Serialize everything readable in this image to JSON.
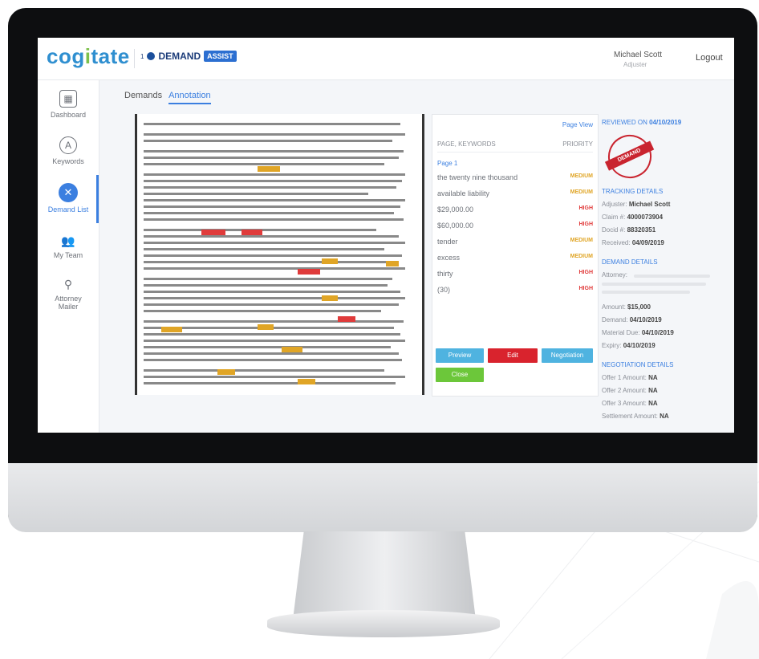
{
  "app": {
    "logo_prefix": "cog",
    "logo_i": "i",
    "logo_suffix": "tate",
    "product_number": "1",
    "product_name": "DEMAND",
    "product_badge": "ASSIST",
    "user_name": "Michael Scott",
    "user_role": "Adjuster",
    "logout": "Logout"
  },
  "sidebar": {
    "items": [
      {
        "label": "Dashboard",
        "icon": "dashboard-icon"
      },
      {
        "label": "Keywords",
        "icon": "keywords-icon"
      },
      {
        "label": "Demand List",
        "icon": "demand-list-icon",
        "active": true
      },
      {
        "label": "My Team",
        "icon": "team-icon"
      },
      {
        "label": "Attorney Mailer",
        "icon": "attorney-mailer-icon"
      }
    ]
  },
  "tabs": [
    {
      "label": "Demands"
    },
    {
      "label": "Annotation",
      "active": true
    }
  ],
  "keywords_panel": {
    "page_view": "Page View",
    "col_keywords": "PAGE, KEYWORDS",
    "col_priority": "PRIORITY",
    "page_label": "Page 1",
    "rows": [
      {
        "keyword": "the twenty nine thousand",
        "priority": "MEDIUM"
      },
      {
        "keyword": "available liability",
        "priority": "MEDIUM"
      },
      {
        "keyword": "$29,000.00",
        "priority": "HIGH"
      },
      {
        "keyword": "$60,000.00",
        "priority": "HIGH"
      },
      {
        "keyword": "tender",
        "priority": "MEDIUM"
      },
      {
        "keyword": "excess",
        "priority": "MEDIUM"
      },
      {
        "keyword": "thirty",
        "priority": "HIGH"
      },
      {
        "keyword": "(30)",
        "priority": "HIGH"
      }
    ],
    "buttons": {
      "preview": "Preview",
      "edit": "Edit",
      "negotiation": "Negotiation",
      "close": "Close"
    }
  },
  "details": {
    "reviewed_label": "REVIEWED ON",
    "reviewed_date": "04/10/2019",
    "stamp_text": "DEMAND",
    "tracking_title": "TRACKING DETAILS",
    "tracking": [
      {
        "label": "Adjuster:",
        "value": "Michael Scott"
      },
      {
        "label": "Claim #:",
        "value": "4000073904"
      },
      {
        "label": "Docid #:",
        "value": "88320351"
      },
      {
        "label": "Received:",
        "value": "04/09/2019"
      }
    ],
    "demand_title": "DEMAND DETAILS",
    "attorney_label": "Attorney:",
    "demand": [
      {
        "label": "Amount:",
        "value": "$15,000"
      },
      {
        "label": "Demand:",
        "value": "04/10/2019"
      },
      {
        "label": "Material Due:",
        "value": "04/10/2019"
      },
      {
        "label": "Expiry:",
        "value": "04/10/2019"
      }
    ],
    "negotiation_title": "NEGOTIATION DETAILS",
    "negotiation": [
      {
        "label": "Offer 1 Amount:",
        "value": "NA"
      },
      {
        "label": "Offer 2 Amount:",
        "value": "NA"
      },
      {
        "label": "Offer 3 Amount:",
        "value": "NA"
      },
      {
        "label": "Settlement Amount:",
        "value": "NA"
      }
    ]
  },
  "colors": {
    "accent": "#3b7fe0",
    "high": "#e03b3b",
    "medium": "#e0a526",
    "preview_btn": "#4fb3e0",
    "edit_btn": "#d9232d",
    "close_btn": "#6cc73a"
  }
}
